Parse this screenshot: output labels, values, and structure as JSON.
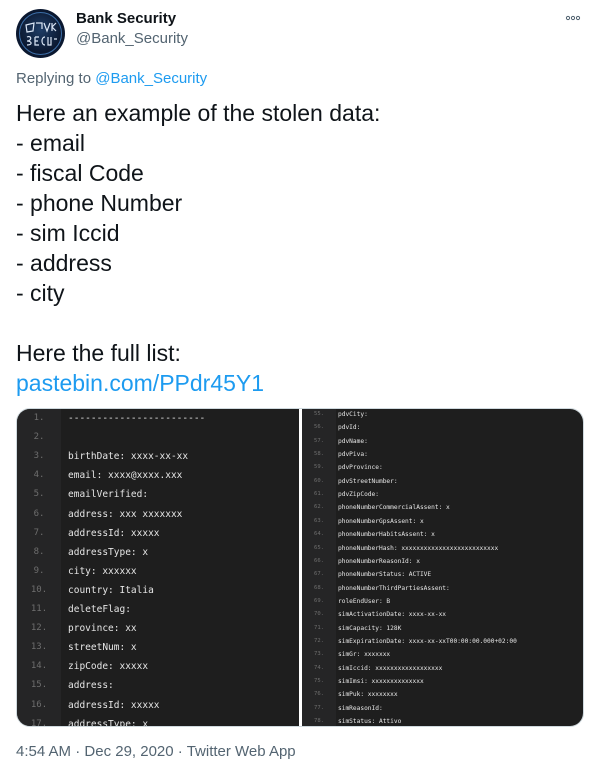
{
  "author": {
    "display_name": "Bank Security",
    "handle": "@Bank_Security",
    "avatar_text": "Bank Security"
  },
  "reply": {
    "prefix": "Replying to ",
    "mention": "@Bank_Security"
  },
  "tweet": {
    "lines": [
      "Here an example of the stolen data:",
      "- email",
      "- fiscal Code",
      "- phone Number",
      "- sim Iccid",
      "- address",
      "- city",
      "",
      "Here the full list:"
    ],
    "link": "pastebin.com/PPdr45Y1"
  },
  "media": {
    "left_lines": [
      {
        "n": "1.",
        "t": "------------------------"
      },
      {
        "n": "2.",
        "t": ""
      },
      {
        "n": "3.",
        "t": "birthDate: xxxx-xx-xx"
      },
      {
        "n": "4.",
        "t": "email: xxxx@xxxx.xxx"
      },
      {
        "n": "5.",
        "t": "emailVerified:"
      },
      {
        "n": "6.",
        "t": "address: xxx xxxxxxx"
      },
      {
        "n": "7.",
        "t": "addressId: xxxxx"
      },
      {
        "n": "8.",
        "t": "addressType: x"
      },
      {
        "n": "9.",
        "t": "city: xxxxxx"
      },
      {
        "n": "10.",
        "t": "country: Italia"
      },
      {
        "n": "11.",
        "t": "deleteFlag:"
      },
      {
        "n": "12.",
        "t": "province: xx"
      },
      {
        "n": "13.",
        "t": "streetNum: x"
      },
      {
        "n": "14.",
        "t": "zipCode: xxxxx"
      },
      {
        "n": "15.",
        "t": "address:"
      },
      {
        "n": "16.",
        "t": "addressId: xxxxx"
      },
      {
        "n": "17.",
        "t": "addressType: x"
      }
    ],
    "right_lines": [
      {
        "n": "55.",
        "t": "pdvCity:"
      },
      {
        "n": "56.",
        "t": "pdvId:"
      },
      {
        "n": "57.",
        "t": "pdvName:"
      },
      {
        "n": "58.",
        "t": "pdvPiva:"
      },
      {
        "n": "59.",
        "t": "pdvProvince:"
      },
      {
        "n": "60.",
        "t": "pdvStreetNumber:"
      },
      {
        "n": "61.",
        "t": "pdvZipCode:"
      },
      {
        "n": "62.",
        "t": "phoneNumberCommercialAssent: x"
      },
      {
        "n": "63.",
        "t": "phoneNumberGpsAssent: x"
      },
      {
        "n": "64.",
        "t": "phoneNumberHabitsAssent: x"
      },
      {
        "n": "65.",
        "t": "phoneNumberHash: xxxxxxxxxxxxxxxxxxxxxxxxxx"
      },
      {
        "n": "66.",
        "t": "phoneNumberReasonId: x"
      },
      {
        "n": "67.",
        "t": "phoneNumberStatus: ACTIVE"
      },
      {
        "n": "68.",
        "t": "phoneNumberThirdPartiesAssent:"
      },
      {
        "n": "69.",
        "t": "roleEndUser: B"
      },
      {
        "n": "70.",
        "t": "simActivationDate: xxxx-xx-xx"
      },
      {
        "n": "71.",
        "t": "simCapacity: 128K"
      },
      {
        "n": "72.",
        "t": "simExpirationDate: xxxx-xx-xxT00:00:00.000+02:00"
      },
      {
        "n": "73.",
        "t": "simGr: xxxxxxx"
      },
      {
        "n": "74.",
        "t": "simIccid: xxxxxxxxxxxxxxxxxx"
      },
      {
        "n": "75.",
        "t": "simImsi: xxxxxxxxxxxxxx"
      },
      {
        "n": "76.",
        "t": "simPuk: xxxxxxxx"
      },
      {
        "n": "77.",
        "t": "simReasonId:"
      },
      {
        "n": "78.",
        "t": "simStatus: Attivo"
      }
    ]
  },
  "footer": {
    "time": "4:54 AM",
    "separator": " · ",
    "date": "Dec 29, 2020",
    "source": "Twitter Web App"
  },
  "colors": {
    "link": "#1d9bf0",
    "secondary_text": "#536471",
    "code_bg": "#1e1e1e"
  }
}
